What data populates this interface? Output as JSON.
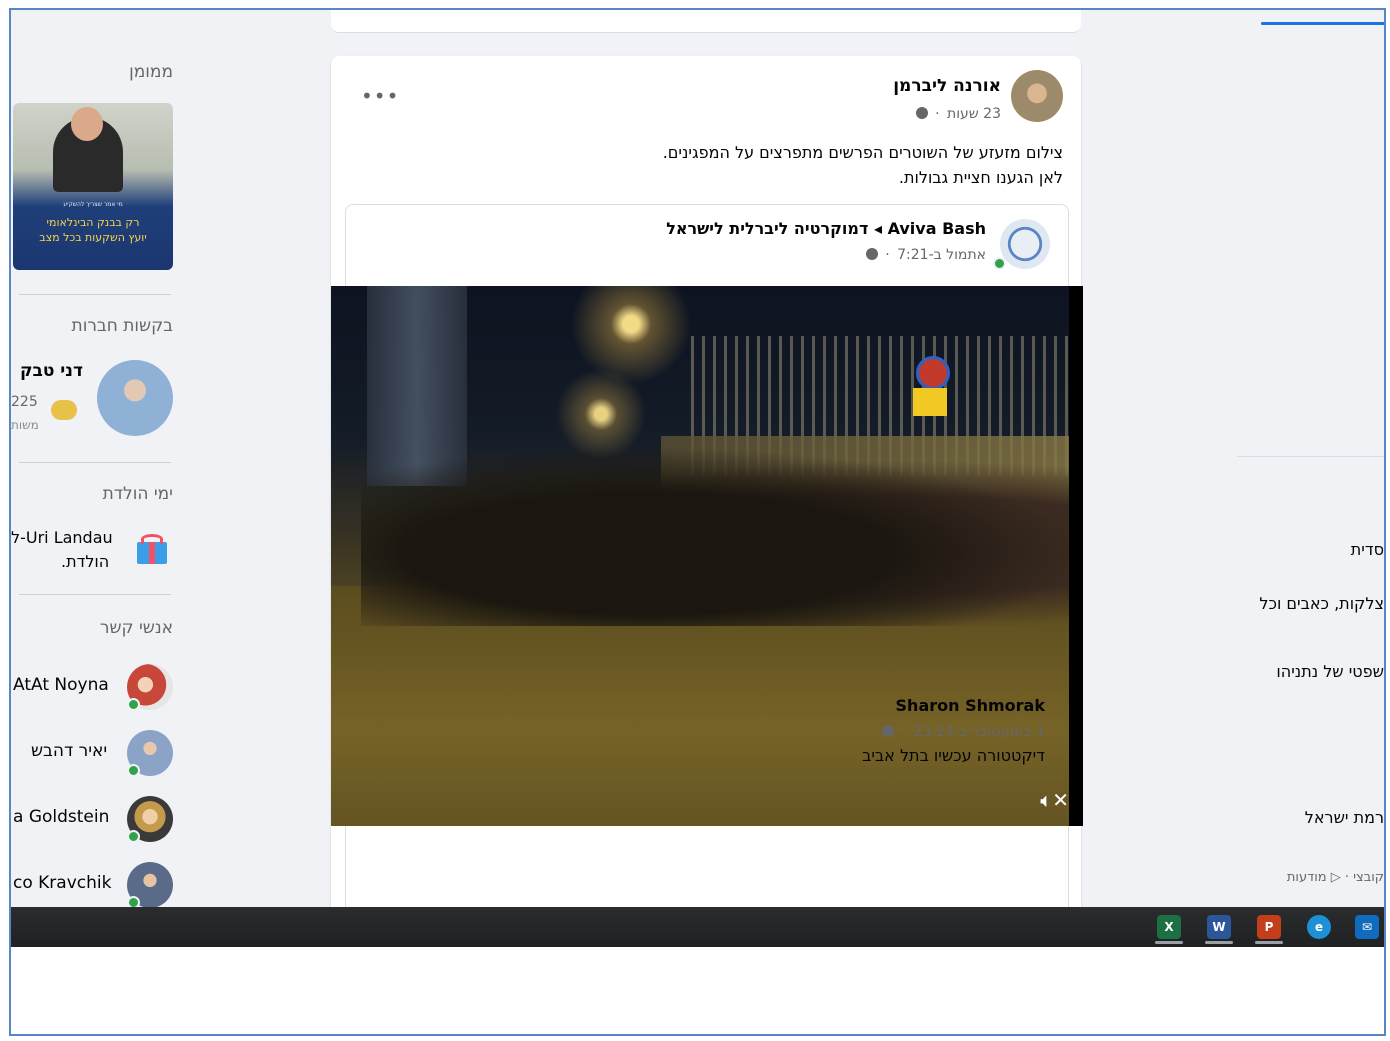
{
  "sidebar": {
    "sponsored_title": "ממומן",
    "ad": {
      "headline": "רק בבנק הבינלאומי",
      "subline": "יועץ השקעות בכל מצב",
      "fine_print": "מי אמר שצריך להשקיע"
    },
    "friend_requests_title": "בקשות חברות",
    "friend_request": {
      "name": "דני טבק",
      "mutual_count": "225",
      "mutual_label": "משות"
    },
    "birthdays_title": "ימי הולדת",
    "birthday": {
      "name_part": "ל-Uri Landau",
      "suffix": "הולדת."
    },
    "contacts_title": "אנשי קשר",
    "contacts": [
      {
        "name": "AtAt Noyna",
        "online": true
      },
      {
        "name": "יאיר דהבש",
        "online": true
      },
      {
        "name": "a Goldstein",
        "online": true
      },
      {
        "name": "co Kravchik",
        "online": true
      }
    ]
  },
  "post": {
    "author": "אורנה ליברמן",
    "time": "23 שעות",
    "more": "•••",
    "text_line1": "צילום מזעזע של השוטרים הפרשים מתפרצים על המפגינים.",
    "text_line2": "לאן הגענו חציית גבולות.",
    "shared": {
      "header": "Aviva Bash ◂ דמוקרטיה ליברלית לישראל",
      "time": "אתמול ב-7:21",
      "video_mute_icon": "speaker-muted-icon",
      "author": "Sharon Shmorak",
      "author_time": "1 באוקטובר ב-23:24",
      "text": "דיקטטורה עכשיו בתל אביב"
    }
  },
  "right_col": {
    "items": [
      "סדית",
      "צלקות, כאבים וכל",
      "שפטי של נתניהו",
      "רמת ישראל",
      "קובצי · ▷ מודעות"
    ]
  },
  "taskbar": {
    "icons": [
      "excel-icon",
      "word-icon",
      "powerpoint-icon",
      "edge-icon",
      "mail-icon"
    ],
    "labels": [
      "X",
      "W",
      "P",
      "e",
      "✉"
    ],
    "colors": [
      "#1d7044",
      "#2b579a",
      "#c43e1c",
      "#1e90d6",
      "#0f6cbd"
    ]
  }
}
